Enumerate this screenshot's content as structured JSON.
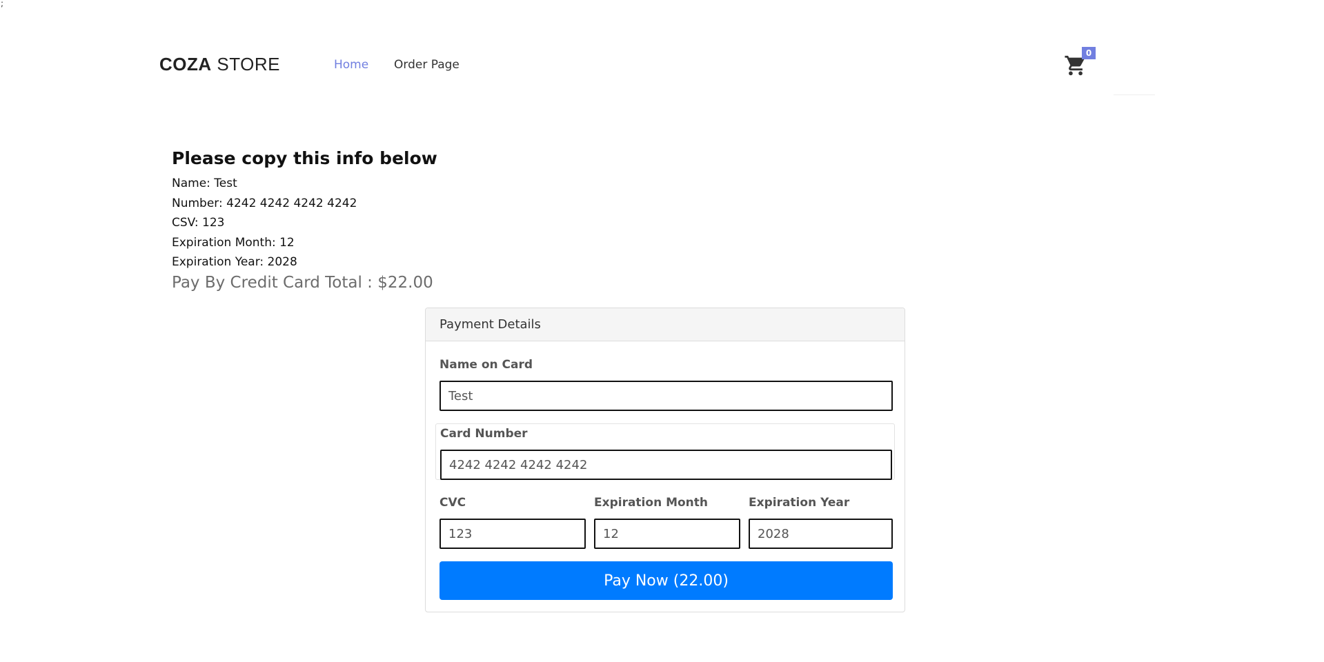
{
  "stray_text": ";",
  "header": {
    "logo_bold": "COZA",
    "logo_light": "STORE",
    "nav": {
      "home": "Home",
      "order": "Order Page"
    },
    "cart_count": "0",
    "cart_icon": "shopping-cart-icon"
  },
  "info": {
    "heading": "Please copy this info below",
    "name_line": "Name: Test",
    "number_line": "Number: 4242 4242 4242 4242",
    "csv_line": "CSV: 123",
    "exp_month_line": "Expiration Month: 12",
    "exp_year_line": "Expiration Year: 2028",
    "total_line": "Pay By Credit Card Total : $22.00"
  },
  "payment": {
    "title": "Payment Details",
    "name_label": "Name on Card",
    "name_value": "Test",
    "card_number_label": "Card Number",
    "card_number_value": "4242 4242 4242 4242",
    "cvc_label": "CVC",
    "cvc_value": "123",
    "exp_month_label": "Expiration Month",
    "exp_month_value": "12",
    "exp_year_label": "Expiration Year",
    "exp_year_value": "2028",
    "pay_button": "Pay Now (22.00)",
    "pay_button_color": "#007bff"
  },
  "colors": {
    "accent": "#717fe0",
    "primary": "#007bff"
  }
}
